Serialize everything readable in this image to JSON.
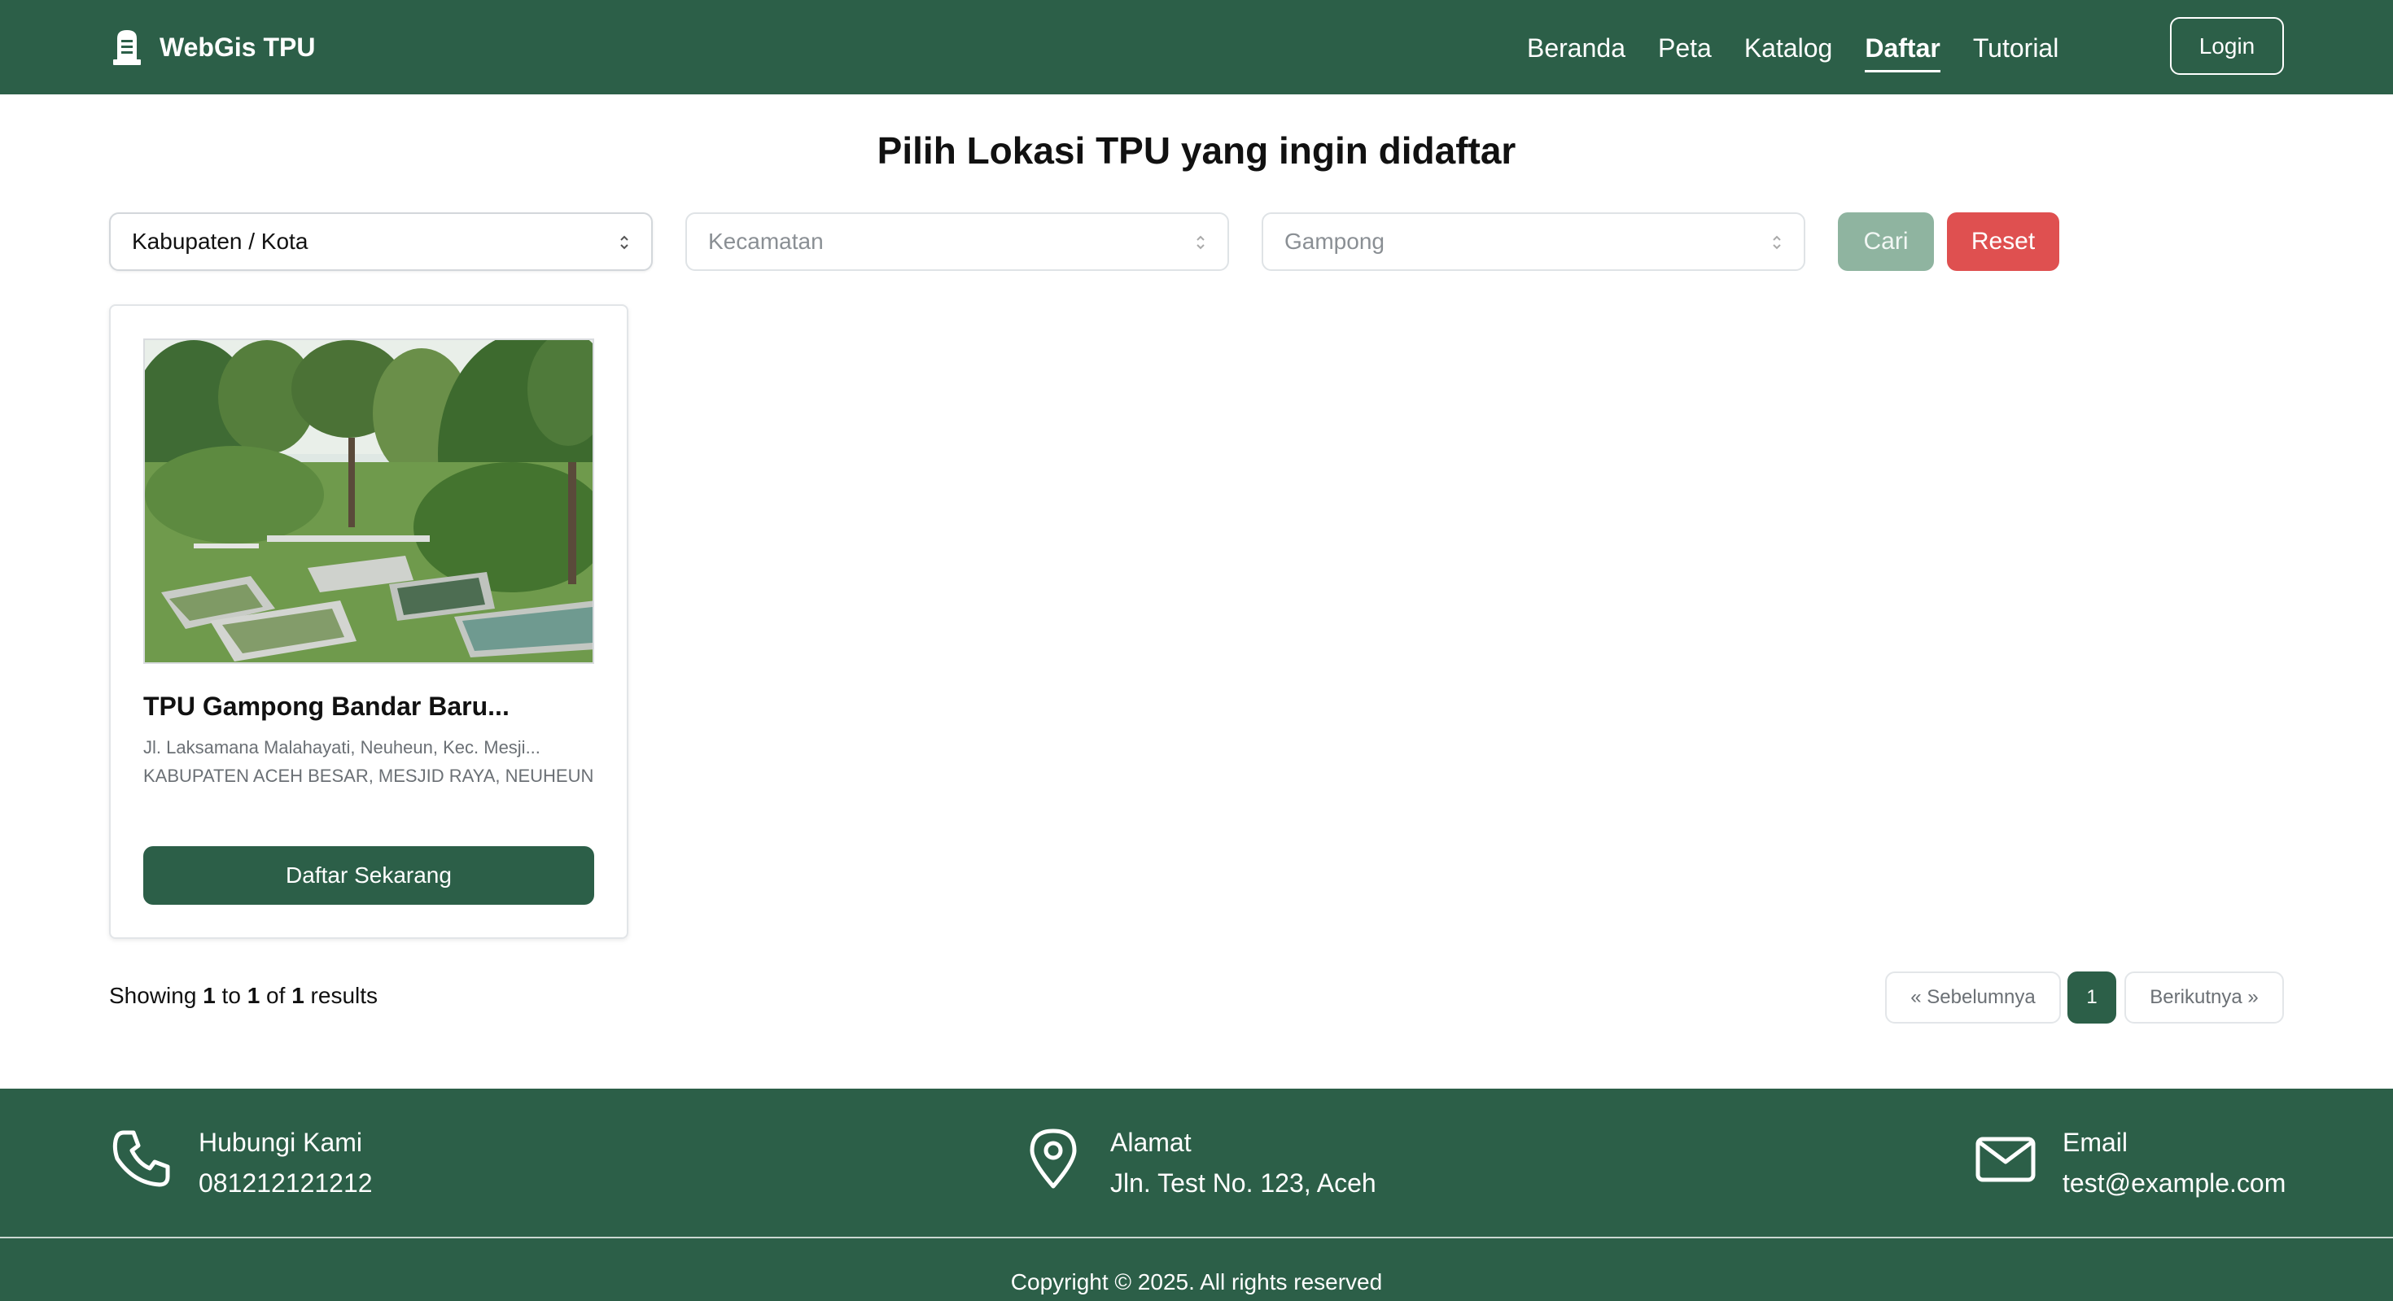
{
  "colors": {
    "primary": "#2c5f48",
    "reset": "#df5050",
    "cari": "#8fb4a0"
  },
  "navbar": {
    "brand": "WebGis TPU",
    "brand_icon": "tombstone-icon",
    "links": [
      "Beranda",
      "Peta",
      "Katalog",
      "Daftar",
      "Tutorial"
    ],
    "active": "Daftar",
    "login": "Login"
  },
  "main": {
    "title": "Pilih Lokasi TPU yang ingin didaftar",
    "filters": {
      "kabupaten": "Kabupaten / Kota",
      "kecamatan": "Kecamatan",
      "gampong": "Gampong",
      "cari": "Cari",
      "reset": "Reset"
    },
    "cards": [
      {
        "title": "TPU Gampong Bandar Baru...",
        "address_line1": "Jl. Laksamana Malahayati, Neuheun, Kec. Mesji...",
        "address_line2": "KABUPATEN ACEH BESAR, MESJID RAYA, NEUHEUN",
        "button": "Daftar Sekarang"
      }
    ],
    "results": {
      "prefix": "Showing",
      "from": "1",
      "to_word": "to",
      "to": "1",
      "of_word": "of",
      "total": "1",
      "suffix": "results"
    },
    "pagination": {
      "prev": "« Sebelumnya",
      "current": "1",
      "next": "Berikutnya »"
    }
  },
  "footer": {
    "contact": {
      "label": "Hubungi Kami",
      "value": "081212121212",
      "icon": "phone-icon"
    },
    "address": {
      "label": "Alamat",
      "value": "Jln. Test No. 123, Aceh",
      "icon": "location-pin-icon"
    },
    "email": {
      "label": "Email",
      "value": "test@example.com",
      "icon": "mail-icon"
    },
    "copyright": "Copyright © 2025. All rights reserved"
  }
}
